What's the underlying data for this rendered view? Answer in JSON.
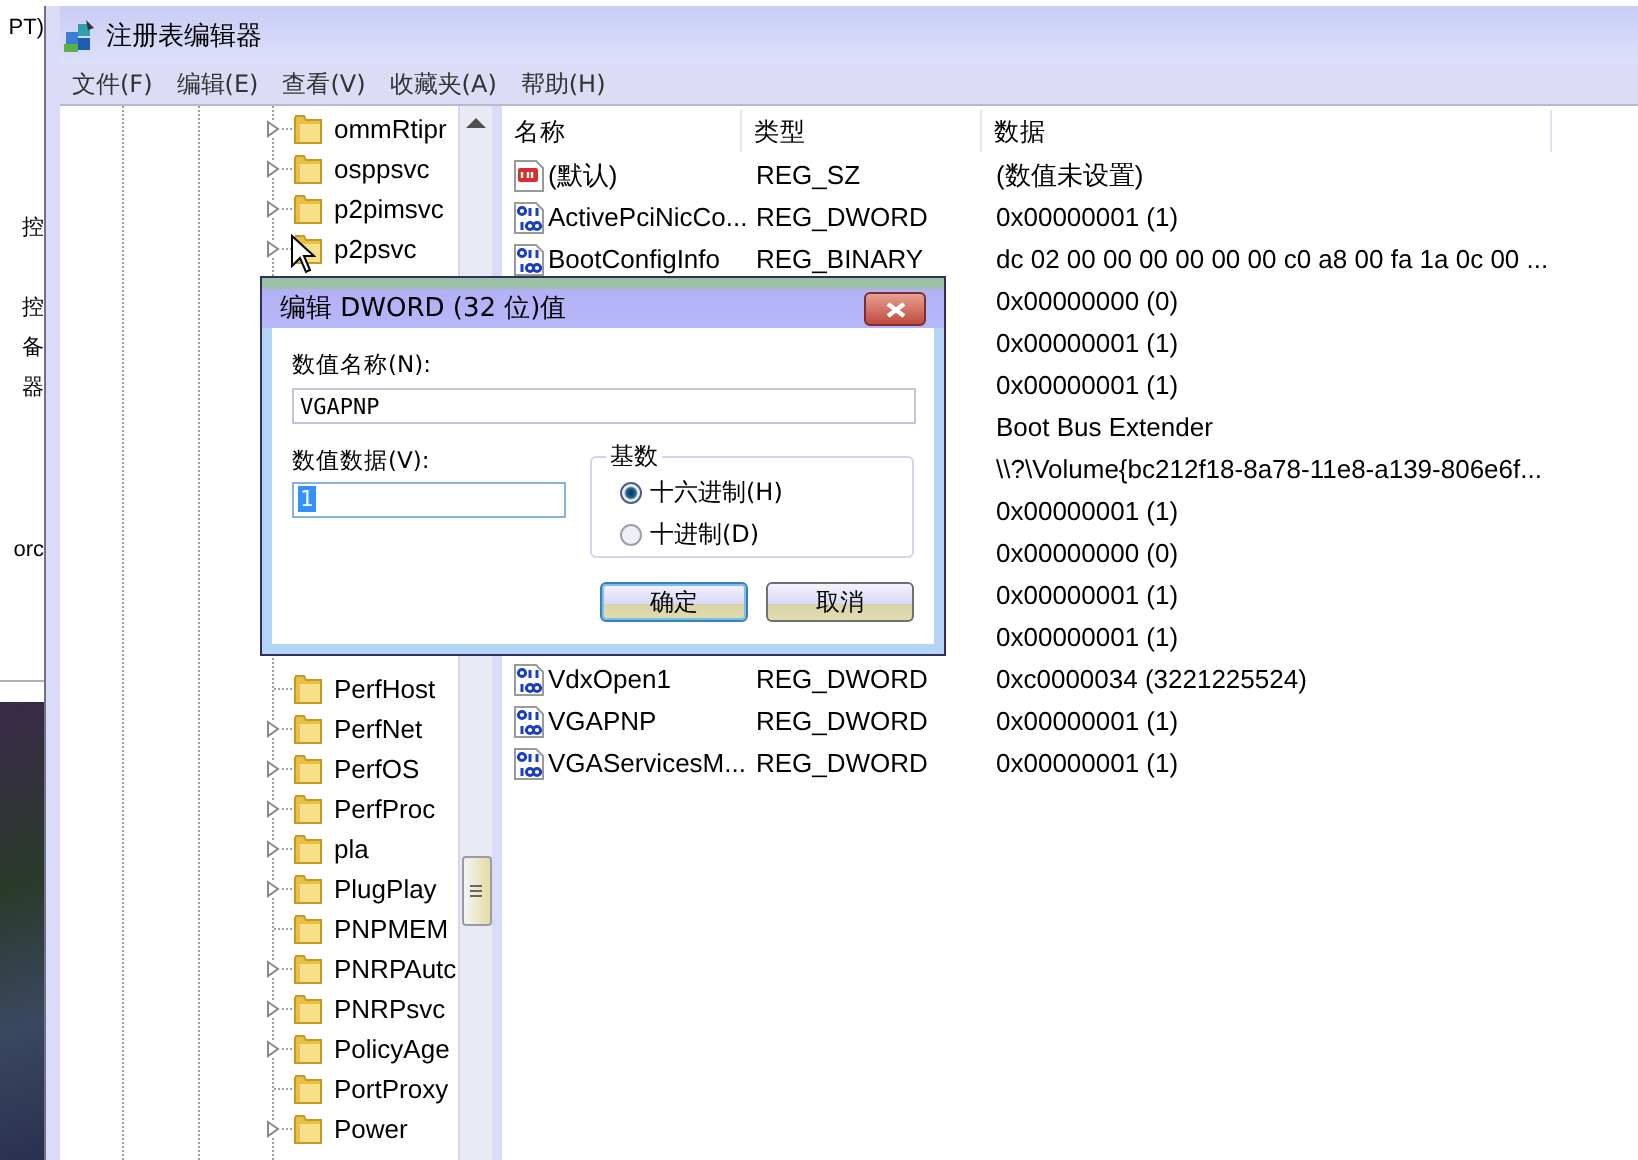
{
  "background_window": {
    "texts": [
      "PT)",
      "控",
      "控",
      "备",
      "器",
      "orc"
    ]
  },
  "window": {
    "title": "注册表编辑器"
  },
  "menu": [
    "文件(F)",
    "编辑(E)",
    "查看(V)",
    "收藏夹(A)",
    "帮助(H)"
  ],
  "tree": {
    "groups": [
      {
        "items": [
          {
            "label": "ommRtipr",
            "expandable": true
          },
          {
            "label": "osppsvc",
            "expandable": true
          },
          {
            "label": "p2pimsvc",
            "expandable": true
          },
          {
            "label": "p2psvc",
            "expandable": true
          }
        ]
      },
      {
        "items": [
          {
            "label": "PerfHost",
            "expandable": false
          },
          {
            "label": "PerfNet",
            "expandable": true
          },
          {
            "label": "PerfOS",
            "expandable": true
          },
          {
            "label": "PerfProc",
            "expandable": true
          },
          {
            "label": "pla",
            "expandable": true
          },
          {
            "label": "PlugPlay",
            "expandable": true
          },
          {
            "label": "PNPMEM",
            "expandable": false
          },
          {
            "label": "PNRPAutc",
            "expandable": true
          },
          {
            "label": "PNRPsvc",
            "expandable": true
          },
          {
            "label": "PolicyAge",
            "expandable": true
          },
          {
            "label": "PortProxy",
            "expandable": false
          },
          {
            "label": "Power",
            "expandable": true
          }
        ]
      }
    ]
  },
  "values": {
    "columns": [
      "名称",
      "类型",
      "数据"
    ],
    "rows": [
      {
        "kind": "string",
        "name": "(默认)",
        "type": "REG_SZ",
        "data": "(数值未设置)"
      },
      {
        "kind": "dword",
        "name": "ActivePciNicCo...",
        "type": "REG_DWORD",
        "data": "0x00000001 (1)"
      },
      {
        "kind": "binary",
        "name": "BootConfigInfo",
        "type": "REG_BINARY",
        "data": "dc 02 00 00 00 00 00 00 c0 a8 00 fa 1a 0c 00 ..."
      },
      {
        "kind": "covered",
        "data": "0x00000000 (0)"
      },
      {
        "kind": "covered",
        "data": "0x00000001 (1)"
      },
      {
        "kind": "covered",
        "data": "0x00000001 (1)"
      },
      {
        "kind": "covered",
        "data": "Boot Bus Extender"
      },
      {
        "kind": "covered",
        "data": "\\\\?\\Volume{bc212f18-8a78-11e8-a139-806e6f..."
      },
      {
        "kind": "covered",
        "data": "0x00000001 (1)"
      },
      {
        "kind": "covered",
        "data": "0x00000000 (0)"
      },
      {
        "kind": "covered",
        "data": "0x00000001 (1)"
      },
      {
        "kind": "covered",
        "data": "0x00000001 (1)"
      },
      {
        "kind": "dword",
        "name": "VdxOpen1",
        "type": "REG_DWORD",
        "data": "0xc0000034 (3221225524)"
      },
      {
        "kind": "dword",
        "name": "VGAPNP",
        "type": "REG_DWORD",
        "data": "0x00000001 (1)"
      },
      {
        "kind": "dword",
        "name": "VGAServicesM...",
        "type": "REG_DWORD",
        "data": "0x00000001 (1)"
      }
    ]
  },
  "dialog": {
    "title": "编辑 DWORD (32 位)值",
    "name_label": "数值名称(N):",
    "name_value": "VGAPNP",
    "data_label": "数值数据(V):",
    "data_value": "1",
    "data_value_selected": true,
    "base": {
      "title": "基数",
      "options": [
        {
          "label": "十六进制(H)",
          "selected": true
        },
        {
          "label": "十进制(D)",
          "selected": false
        }
      ]
    },
    "buttons": [
      {
        "label": "确定",
        "default": true
      },
      {
        "label": "取消",
        "default": false
      }
    ]
  }
}
